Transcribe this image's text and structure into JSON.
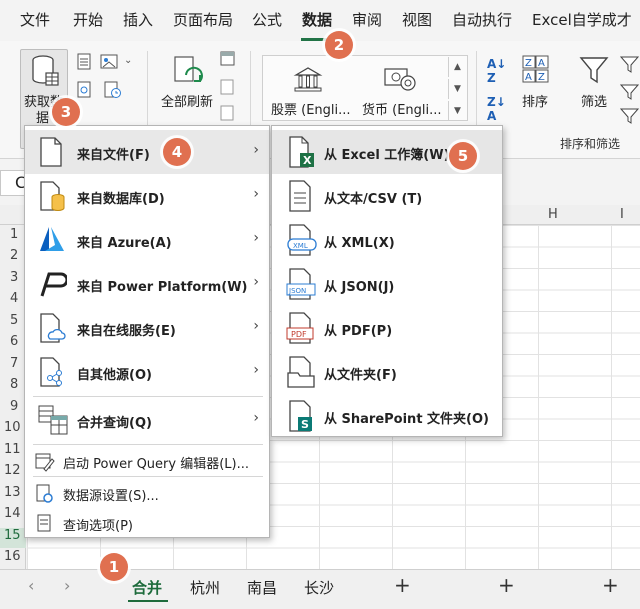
{
  "menubar": {
    "items": [
      "文件",
      "开始",
      "插入",
      "页面布局",
      "公式",
      "数据",
      "审阅",
      "视图",
      "自动执行",
      "Excel自学成才"
    ],
    "active_index": 5
  },
  "ribbon": {
    "get_data_label_line1": "获取数",
    "get_data_label_line2": "据",
    "refresh_all_label": "全部刷新",
    "stocks_label": "股票 (Engli...",
    "currencies_label": "货币 (Engli...",
    "sort_label": "排序",
    "filter_label": "筛选",
    "sort_filter_group_label": "排序和筛选"
  },
  "namebox": {
    "value": "C"
  },
  "grid": {
    "col_headers": [
      "H",
      "I"
    ],
    "row_numbers": [
      "1",
      "2",
      "3",
      "4",
      "5",
      "6",
      "7",
      "8",
      "9",
      "10",
      "11",
      "12",
      "13",
      "14",
      "15",
      "16"
    ],
    "selected_row": "15"
  },
  "sheet_tabs": {
    "tabs": [
      "合并",
      "杭州",
      "南昌",
      "长沙"
    ],
    "active_index": 0,
    "add_label": "+"
  },
  "get_data_menu": {
    "items": [
      {
        "label": "来自文件(F)",
        "icon": "file-icon",
        "has_submenu": true
      },
      {
        "label": "来自数据库(D)",
        "icon": "database-icon",
        "has_submenu": true
      },
      {
        "label": "来自 Azure(A)",
        "icon": "azure-icon",
        "has_submenu": true
      },
      {
        "label": "来自 Power Platform(W)",
        "icon": "power-platform-icon",
        "has_submenu": true
      },
      {
        "label": "来自在线服务(E)",
        "icon": "online-services-icon",
        "has_submenu": true
      },
      {
        "label": "自其他源(O)",
        "icon": "other-sources-icon",
        "has_submenu": true
      },
      {
        "label": "合并查询(Q)",
        "icon": "combine-queries-icon",
        "has_submenu": true
      }
    ],
    "footer_items": [
      {
        "label": "启动 Power Query 编辑器(L)...",
        "icon": "power-query-editor-icon"
      },
      {
        "label": "数据源设置(S)...",
        "icon": "data-source-settings-icon"
      },
      {
        "label": "查询选项(P)",
        "icon": "query-options-icon"
      }
    ]
  },
  "from_file_submenu": {
    "items": [
      {
        "label": "从 Excel 工作簿(W)",
        "icon": "excel-workbook-icon"
      },
      {
        "label": "从文本/CSV (T)",
        "icon": "text-csv-icon"
      },
      {
        "label": "从 XML(X)",
        "icon": "xml-icon"
      },
      {
        "label": "从 JSON(J)",
        "icon": "json-icon"
      },
      {
        "label": "从 PDF(P)",
        "icon": "pdf-icon"
      },
      {
        "label": "从文件夹(F)",
        "icon": "folder-icon"
      },
      {
        "label": "从 SharePoint 文件夹(O)",
        "icon": "sharepoint-folder-icon"
      }
    ],
    "icon_text": {
      "xml": "XML",
      "json": "JSON",
      "pdf": "PDF",
      "excel": "X",
      "sharepoint": "S"
    }
  },
  "callouts": [
    "1",
    "2",
    "3",
    "4",
    "5"
  ],
  "colors": {
    "accent_green": "#217346",
    "callout": "#e07050"
  }
}
